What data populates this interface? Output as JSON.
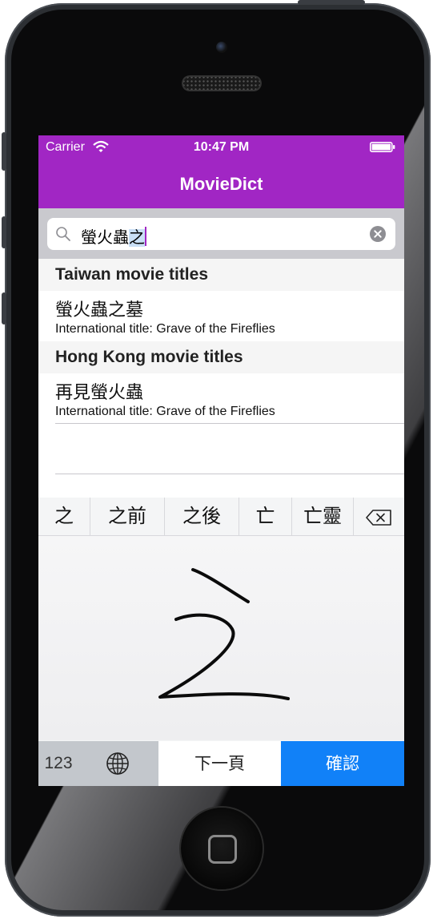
{
  "status_bar": {
    "carrier": "Carrier",
    "time": "10:47 PM"
  },
  "nav": {
    "title": "MovieDict"
  },
  "search": {
    "text_plain": "螢火蟲",
    "text_marked": "之"
  },
  "sections": [
    {
      "header": "Taiwan movie titles",
      "rows": [
        {
          "title": "螢火蟲之墓",
          "subtitle": "International title: Grave of the Fireflies"
        }
      ]
    },
    {
      "header": "Hong Kong movie titles",
      "rows": [
        {
          "title": "再見螢火蟲",
          "subtitle": "International title: Grave of the Fireflies"
        }
      ]
    }
  ],
  "keyboard": {
    "candidates": [
      "之",
      "之前",
      "之後",
      "亡",
      "亡靈"
    ],
    "keys": {
      "numbers": "123",
      "next_page": "下一頁",
      "confirm": "確認"
    },
    "icons": {
      "globe": "globe-icon",
      "backspace": "backspace-icon"
    }
  },
  "colors": {
    "nav_purple": "#a126c4",
    "confirm_blue": "#1181f8",
    "search_bar_gray": "#c9c9ce"
  }
}
